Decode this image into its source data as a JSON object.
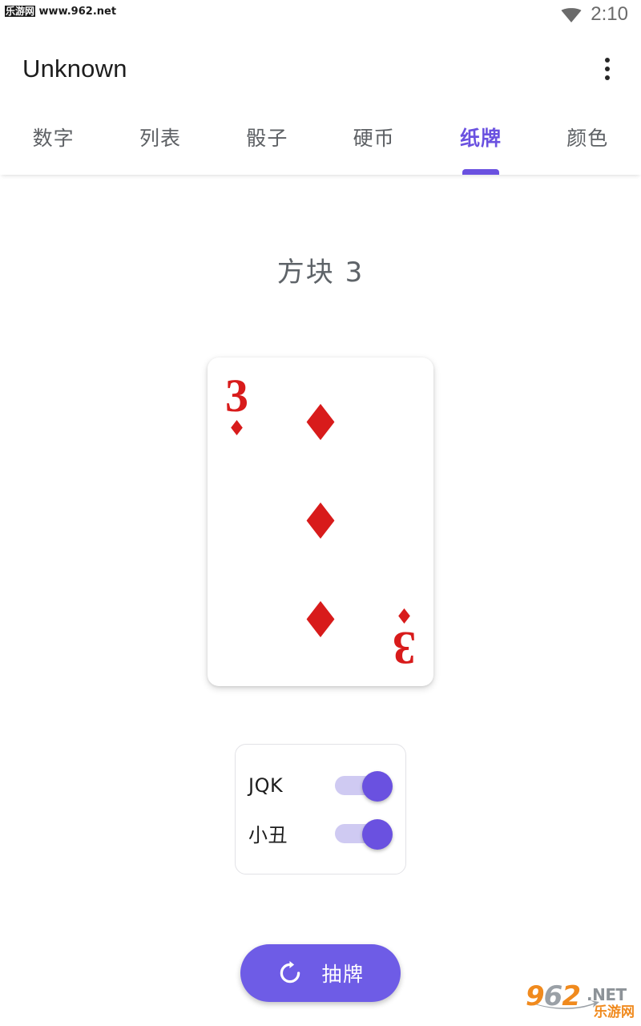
{
  "status_bar": {
    "watermark_text_cn": "乐游网",
    "watermark_text_url": "www.962.net",
    "wifi_icon": "wifi-icon",
    "time": "2:10"
  },
  "app_bar": {
    "title": "Unknown",
    "overflow_icon": "more-vertical-icon"
  },
  "tabs": [
    {
      "label": "数字",
      "active": false
    },
    {
      "label": "列表",
      "active": false
    },
    {
      "label": "骰子",
      "active": false
    },
    {
      "label": "硬币",
      "active": false
    },
    {
      "label": "纸牌",
      "active": true
    },
    {
      "label": "颜色",
      "active": false
    }
  ],
  "main": {
    "result_title": "方块 3",
    "card": {
      "rank": "3",
      "suit_symbol": "♦",
      "suit_name": "diamonds",
      "color": "#d81b1b",
      "pip_count": 3
    },
    "options": [
      {
        "label": "JQK",
        "enabled": true
      },
      {
        "label": "小丑",
        "enabled": true
      }
    ],
    "draw_button": {
      "label": "抽牌",
      "icon": "refresh-icon",
      "color": "#6e5ce6"
    }
  },
  "watermark_bottom": {
    "number": "962",
    "domain": ".NET",
    "cn": "乐游网"
  },
  "theme": {
    "accent": "#6a51e0",
    "card_red": "#d81b1b",
    "text_primary": "#1d1d1d",
    "text_secondary": "#5d6064",
    "background": "#ffffff"
  }
}
